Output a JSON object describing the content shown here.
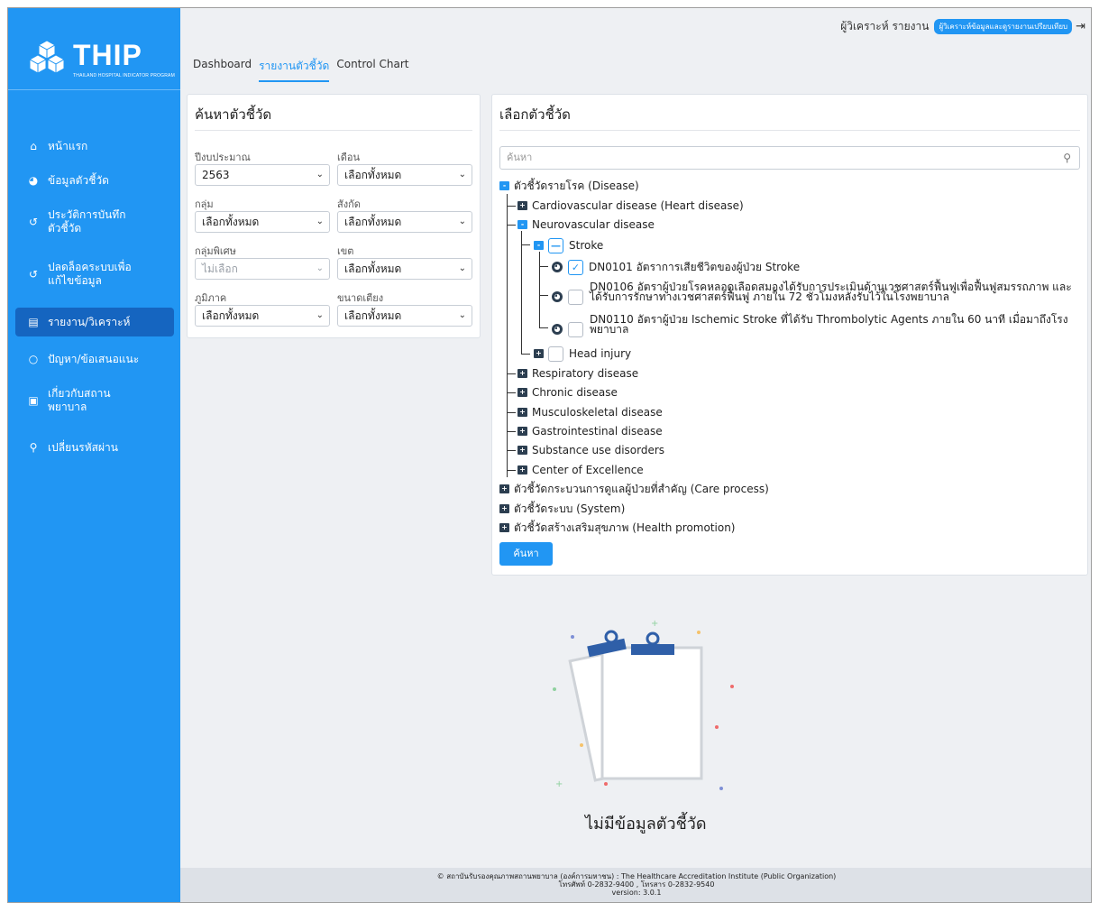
{
  "app": {
    "logo_text": "THIP",
    "logo_subtitle": "THAILAND HOSPITAL INDICATOR PROGRAM"
  },
  "sidebar": {
    "items": [
      {
        "label": "หน้าแรก",
        "icon": "home-icon"
      },
      {
        "label": "ข้อมูลตัวชี้วัด",
        "icon": "dashboard-gauge-icon"
      },
      {
        "label": "ประวัติการบันทึก\nตัวชี้วัด",
        "icon": "history-icon"
      },
      {
        "label": "ปลดล็อคระบบเพื่อ\nแก้ไขข้อมูล",
        "icon": "history-icon"
      },
      {
        "label": "รายงาน/วิเคราะห์",
        "icon": "chart-icon",
        "active": true
      },
      {
        "label": "ปัญหา/ข้อเสนอแนะ",
        "icon": "comment-icon"
      },
      {
        "label": "เกี่ยวกับสถาน\nพยาบาล",
        "icon": "hospital-icon"
      },
      {
        "label": "เปลี่ยนรหัสผ่าน",
        "icon": "key-icon"
      }
    ]
  },
  "topbar": {
    "user": "ผู้วิเคราะห์ รายงาน",
    "role_badge": "ผู้วิเคราะห์ข้อมูลและดูรายงานเปรียบเทียบ"
  },
  "tabs": [
    {
      "label": "Dashboard"
    },
    {
      "label": "รายงานตัวชี้วัด",
      "active": true
    },
    {
      "label": "Control Chart"
    }
  ],
  "filter": {
    "title": "ค้นหาตัวชี้วัด",
    "fields": {
      "year": {
        "label": "ปีงบประมาณ",
        "value": "2563"
      },
      "month": {
        "label": "เดือน",
        "value": "เลือกทั้งหมด"
      },
      "group": {
        "label": "กลุ่ม",
        "value": "เลือกทั้งหมด"
      },
      "affiliation": {
        "label": "สังกัด",
        "value": "เลือกทั้งหมด"
      },
      "special_group": {
        "label": "กลุ่มพิเศษ",
        "value": "ไม่เลือก"
      },
      "zone": {
        "label": "เขต",
        "value": "เลือกทั้งหมด"
      },
      "region": {
        "label": "ภูมิภาค",
        "value": "เลือกทั้งหมด"
      },
      "bed_size": {
        "label": "ขนาดเตียง",
        "value": "เลือกทั้งหมด"
      }
    }
  },
  "selector": {
    "title": "เลือกตัวชี้วัด",
    "search_placeholder": "ค้นหา",
    "search_button": "ค้นหา",
    "tree": {
      "disease": "ตัวชี้วัดรายโรค (Disease)",
      "cardio": "Cardiovascular disease (Heart disease)",
      "neuro": "Neurovascular disease",
      "stroke": "Stroke",
      "dn0101": "DN0101 อัตราการเสียชีวิตของผู้ป่วย Stroke",
      "dn0106": "DN0106 อัตราผู้ป่วยโรคหลอดเลือดสมองได้รับการประเมินด้านเวชศาสตร์ฟื้นฟูเพื่อฟื้นฟูสมรรถภาพ และได้รับการรักษาทางเวชศาสตร์ฟื้นฟู ภายใน 72 ชั่วโมงหลังรับไว้ในโรงพยาบาล",
      "dn0110": "DN0110 อัตราผู้ป่วย Ischemic Stroke ที่ได้รับ Thrombolytic Agents ภายใน 60 นาที เมื่อมาถึงโรงพยาบาล",
      "head_injury": "Head injury",
      "respiratory": "Respiratory disease",
      "chronic": "Chronic disease",
      "musculo": "Musculoskeletal disease",
      "gastro": "Gastrointestinal disease",
      "substance": "Substance use disorders",
      "coe": "Center of Excellence",
      "care_process": "ตัวชี้วัดกระบวนการดูแลผู้ป่วยที่สำคัญ (Care process)",
      "system": "ตัวชี้วัดระบบ (System)",
      "health_promotion": "ตัวชี้วัดสร้างเสริมสุขภาพ (Health promotion)"
    }
  },
  "empty_state": {
    "text": "ไม่มีข้อมูลตัวชี้วัด"
  },
  "footer": {
    "line1": "© สถาบันรับรองคุณภาพสถานพยาบาล (องค์การมหาชน) : The Healthcare Accreditation Institute (Public Organization)",
    "line2": "โทรศัพท์ 0-2832-9400 , โทรสาร 0-2832-9540",
    "line3": "version: 3.0.1"
  },
  "colors": {
    "primary": "#2196f3",
    "sidebar_active": "#1565c0",
    "folder": "#2c3e50"
  }
}
